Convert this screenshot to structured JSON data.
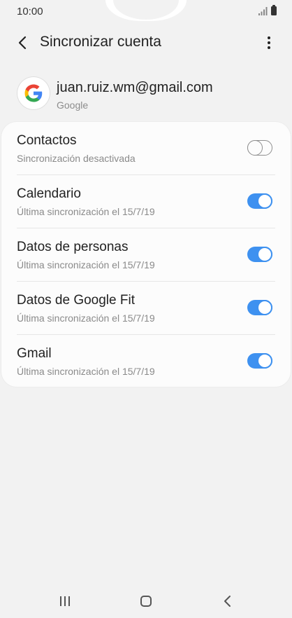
{
  "status_bar": {
    "time": "10:00",
    "icons": [
      "signal-icon",
      "battery-icon"
    ]
  },
  "app_bar": {
    "back_icon": "back-arrow-icon",
    "title": "Sincronizar cuenta",
    "more_icon": "more-vert-icon"
  },
  "account": {
    "email": "juan.ruiz.wm@gmail.com",
    "type": "Google",
    "avatar_icon": "google-logo-icon"
  },
  "sync_items": [
    {
      "title": "Contactos",
      "subtitle": "Sincronización desactivada",
      "enabled": false
    },
    {
      "title": "Calendario",
      "subtitle": "Última sincronización el 15/7/19",
      "enabled": true
    },
    {
      "title": "Datos de personas",
      "subtitle": "Última sincronización el 15/7/19",
      "enabled": true
    },
    {
      "title": "Datos de Google Fit",
      "subtitle": "Última sincronización el 15/7/19",
      "enabled": true
    },
    {
      "title": "Gmail",
      "subtitle": "Última sincronización el 15/7/19",
      "enabled": true
    }
  ],
  "nav_bar": {
    "icons": [
      "recent-apps-icon",
      "home-icon",
      "back-icon"
    ]
  },
  "colors": {
    "background": "#f2f2f2",
    "card": "#fcfcfc",
    "accent": "#3e91f0",
    "text_primary": "#222222",
    "text_secondary": "#8a8a8a"
  }
}
